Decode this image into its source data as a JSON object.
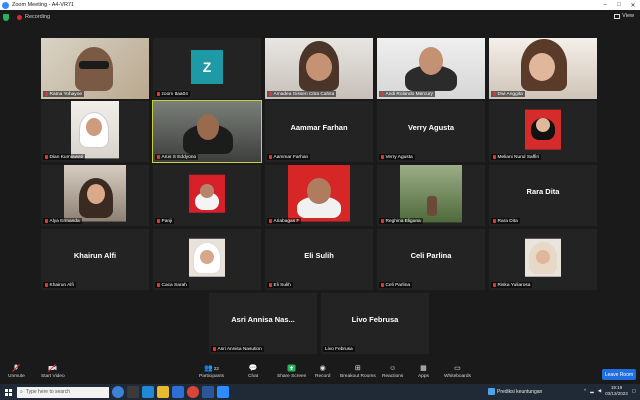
{
  "window": {
    "title": "Zoom Meeting - A4-VR71"
  },
  "meeting": {
    "recording_label": "Recording",
    "view_label": "View"
  },
  "tiles": [
    {
      "name": "Ratna Yohayoe"
    },
    {
      "name": "zoom ttaa04",
      "avatar_letter": "Z"
    },
    {
      "name": "Amadea Gissen Citra Cahita"
    },
    {
      "name": "Andi Rolando Mercury"
    },
    {
      "name": "Dwi Anggita"
    },
    {
      "name": "Dian Kurniawati"
    },
    {
      "name": "Arus S Eddyono"
    },
    {
      "name": "Aammar Farhan",
      "display": "Aammar Farhan"
    },
    {
      "name": "Verry Agusta",
      "display": "Verry Agusta"
    },
    {
      "name": "Meliani Nurul Saffiri"
    },
    {
      "name": "Alya Ermanda"
    },
    {
      "name": "Panji"
    },
    {
      "name": "Ariabagas F"
    },
    {
      "name": "Reghina Eliguna"
    },
    {
      "name": "Rara Dita",
      "display": "Rara Dita"
    },
    {
      "name": "Khairun Alfi",
      "display": "Khairun Alfi"
    },
    {
      "name": "Caca Sarah"
    },
    {
      "name": "Eli Sulih",
      "display": "Eli Sulih"
    },
    {
      "name": "Celi Parlina",
      "display": "Celi Parlina"
    },
    {
      "name": "Riska Yuliarosa"
    },
    {
      "name": "Asri Annisa Nasution",
      "display": "Asri Annisa Nas..."
    },
    {
      "name": "Livo Februsa",
      "display": "Livo Februsa"
    }
  ],
  "toolbar": {
    "unmute": "Unmute",
    "start_video": "Start Video",
    "participants": "Participants",
    "participants_count": "22",
    "chat": "Chat",
    "share_screen": "Share Screen",
    "record": "Record",
    "breakout": "Breakout Rooms",
    "reactions": "Reactions",
    "apps": "Apps",
    "whiteboards": "Whiteboards",
    "leave": "Leave Room"
  },
  "taskbar": {
    "search_placeholder": "Type here to search",
    "weather": "Prediksi keuntungan",
    "time": "19:19",
    "date": "03/13/2023"
  },
  "colors": {
    "accent": "#2d8cff",
    "leave": "#1f6fe0",
    "muted_mic": "#e53535",
    "active_speaker": "#c9d13a"
  }
}
